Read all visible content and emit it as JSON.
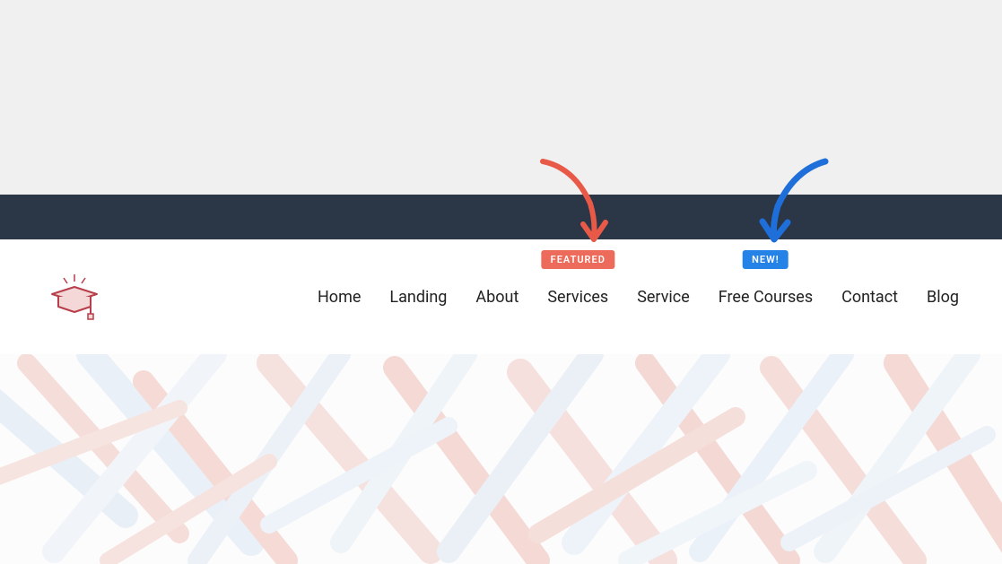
{
  "nav": {
    "items": [
      {
        "label": "Home"
      },
      {
        "label": "Landing"
      },
      {
        "label": "About"
      },
      {
        "label": "Services",
        "badge": "FEATURED",
        "badge_type": "featured"
      },
      {
        "label": "Service"
      },
      {
        "label": "Free Courses",
        "badge": "NEW!",
        "badge_type": "new"
      },
      {
        "label": "Contact"
      },
      {
        "label": "Blog"
      }
    ]
  },
  "badges": {
    "featured": "FEATURED",
    "new": "NEW!"
  },
  "colors": {
    "dark_bar": "#2b3647",
    "badge_featured": "#ed6b5a",
    "badge_new": "#2583e8",
    "logo_accent": "#b73e4a"
  }
}
